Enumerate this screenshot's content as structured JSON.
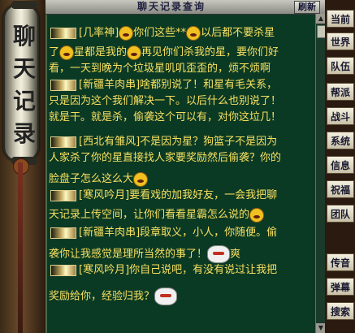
{
  "scroll": {
    "label": "聊天记录"
  },
  "window": {
    "title": "聊天记录查询",
    "refresh_label": "刷新"
  },
  "chat": {
    "lines": [
      {
        "channel": true,
        "name": "[几率神]",
        "text": "你们这些**",
        "emoji_mid": true,
        "text2": "以后都不要杀星",
        "emoji_end": false
      },
      {
        "channel": false,
        "name": "",
        "text": "了",
        "emoji_mid": true,
        "text2": "星都是我的",
        "text3": "再见你们杀我的星，要你们好"
      },
      {
        "channel": false,
        "text": "看，一天到晚为个垃圾星叽叽歪歪的，烦不烦啊"
      },
      {
        "channel": true,
        "name": "[新疆羊肉串]",
        "text": "啥都别说了！和星有毛关系，"
      },
      {
        "channel": false,
        "text": "只是因为这个我们解决一下。以后什么也别说了！"
      },
      {
        "channel": false,
        "text": "就是干。就是杀，偷袭这个可以有，对你这垃几！"
      },
      {
        "channel": false,
        "text": ""
      },
      {
        "channel": true,
        "name": "[西北有雏风]",
        "text": "不是因为星？狗篮子不是因为"
      },
      {
        "channel": false,
        "text": "人家杀了你的星直接找人家要奖励然后偷袭？你的"
      },
      {
        "channel": false,
        "text": "脸盘子怎么这么大"
      },
      {
        "channel": true,
        "name": "[寒风吟月]",
        "text": "要看戏的加我好友，一会我把聊"
      },
      {
        "channel": false,
        "text": "天记录上传空间，让你们看看星霸怎么说的"
      },
      {
        "channel": true,
        "name": "[新疆羊肉串]",
        "text": "段章取义，小人，你随便。偷"
      },
      {
        "channel": false,
        "text": "袭你让我感觉是理所当然的事了！",
        "text2": "爽"
      },
      {
        "channel": true,
        "name": "[寒风吟月]",
        "text": "你自己说吧，有没有说过让我把"
      },
      {
        "channel": false,
        "text": "奖励给你，经验归我？"
      }
    ]
  },
  "tabs": [
    "当前",
    "世界",
    "队伍",
    "帮派",
    "战斗",
    "系统",
    "信息",
    "祝福",
    "团队",
    "传音",
    "弹幕",
    "搜索"
  ],
  "colors": {
    "chat_text": "#f8e060",
    "panel_bg": "#0b3a24"
  }
}
